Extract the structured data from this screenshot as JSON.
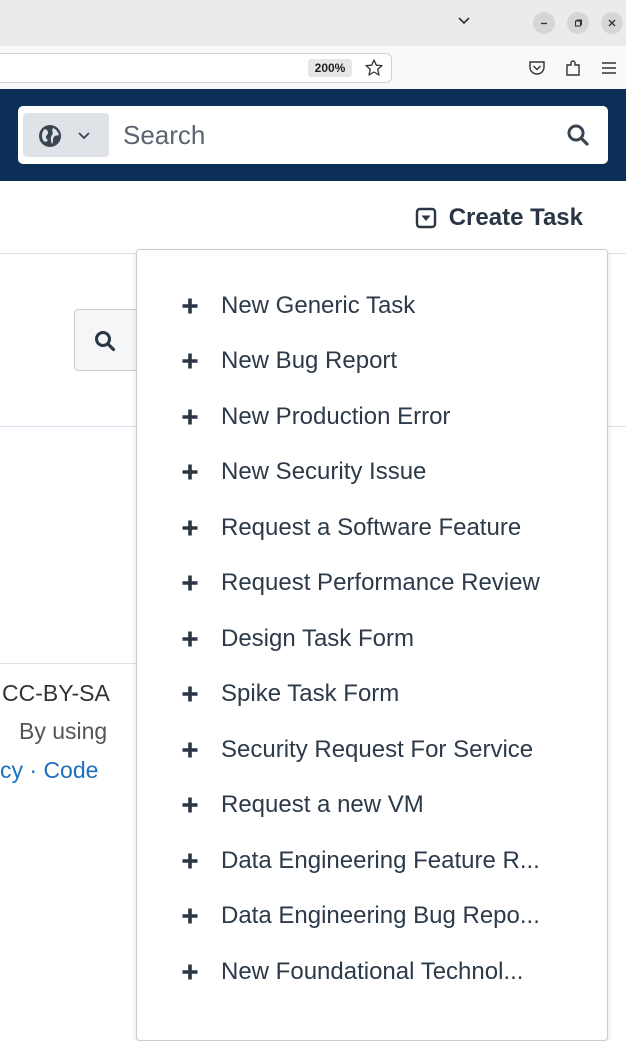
{
  "browser": {
    "zoom": "200%"
  },
  "header": {
    "search_placeholder": "Search"
  },
  "page": {
    "create_task_label": "Create Task",
    "footer_line1": "CC-BY-SA",
    "footer_line2": "By using",
    "footer_line3": "cy · Code"
  },
  "dropdown": {
    "items": [
      {
        "label": "New Generic Task",
        "icon": "plus-icon"
      },
      {
        "label": "New Bug Report",
        "icon": "plus-icon"
      },
      {
        "label": "New Production Error",
        "icon": "plus-icon"
      },
      {
        "label": "New Security Issue",
        "icon": "plus-icon"
      },
      {
        "label": "Request a Software Feature",
        "icon": "plus-icon"
      },
      {
        "label": "Request Performance Review",
        "icon": "plus-icon"
      },
      {
        "label": "Design Task Form",
        "icon": "plus-icon"
      },
      {
        "label": "Spike Task Form",
        "icon": "plus-icon"
      },
      {
        "label": "Security Request For Service",
        "icon": "plus-icon"
      },
      {
        "label": "Request a new VM",
        "icon": "plus-icon"
      },
      {
        "label": "Data Engineering Feature R...",
        "icon": "plus-icon"
      },
      {
        "label": "Data Engineering Bug Repo...",
        "icon": "plus-icon"
      },
      {
        "label": "New Foundational Technol...",
        "icon": "plus-icon"
      }
    ]
  },
  "colors": {
    "header_bg": "#0c2f57",
    "link": "#1f6fbf",
    "menu_text": "#2d3a49"
  }
}
